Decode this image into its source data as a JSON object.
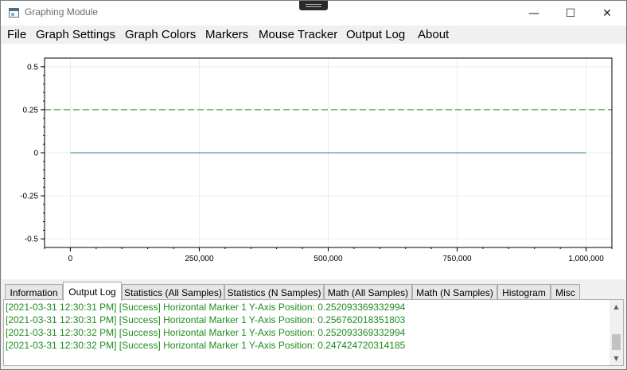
{
  "window": {
    "title": "Graphing Module",
    "minimize_glyph": "—",
    "maximize_glyph": "☐",
    "close_glyph": "✕"
  },
  "menu": {
    "items": [
      "File",
      "Graph Settings",
      "Graph Colors",
      "Markers",
      "Mouse Tracker",
      "Output Log",
      "About"
    ]
  },
  "chart_data": {
    "type": "line",
    "x": [
      0,
      1000000
    ],
    "series": [
      {
        "values": [
          0,
          0
        ],
        "color": "#3a7fa0"
      }
    ],
    "horizontal_markers": [
      {
        "label": "Horizontal Marker 1",
        "y": 0.25,
        "style": "dashed",
        "color": "#2e8b2e"
      }
    ],
    "xlim": [
      -50000,
      1050000
    ],
    "ylim": [
      -0.55,
      0.55
    ],
    "x_ticks": [
      0,
      250000,
      500000,
      750000,
      1000000
    ],
    "x_tick_labels": [
      "0",
      "250,000",
      "500,000",
      "750,000",
      "1,000,000"
    ],
    "y_ticks": [
      0.5,
      0.25,
      0,
      -0.25,
      -0.5
    ],
    "y_tick_labels": [
      "0.5",
      "0.25",
      "0",
      "-0.25",
      "-0.5"
    ],
    "grid": true,
    "title": "",
    "xlabel": "",
    "ylabel": ""
  },
  "tabs": {
    "items": [
      "Information",
      "Output Log",
      "Statistics (All Samples)",
      "Statistics (N Samples)",
      "Math (All Samples)",
      "Math (N Samples)",
      "Histogram",
      "Misc"
    ],
    "active": "Output Log"
  },
  "log": {
    "lines": [
      "[2021-03-31 12:30:31 PM] [Success] Horizontal Marker 1 Y-Axis Position: 0.252093369332994",
      "[2021-03-31 12:30:31 PM] [Success] Horizontal Marker 1 Y-Axis Position: 0.256762018351803",
      "[2021-03-31 12:30:32 PM] [Success] Horizontal Marker 1 Y-Axis Position: 0.252093369332994",
      "[2021-03-31 12:30:32 PM] [Success] Horizontal Marker 1 Y-Axis Position: 0.247424720314185"
    ],
    "color": "#1f8c1f"
  },
  "scrollbar": {
    "up_glyph": "▲",
    "down_glyph": "▼"
  }
}
